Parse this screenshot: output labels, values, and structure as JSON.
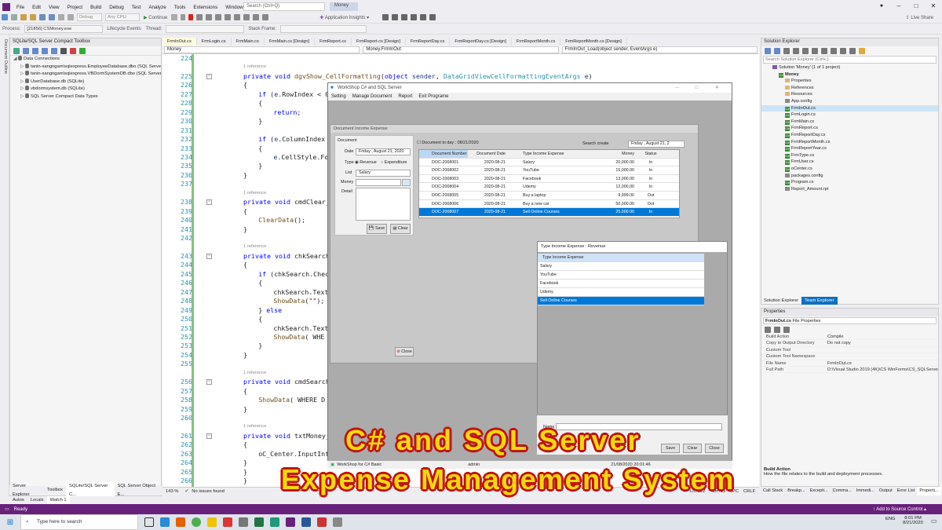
{
  "menubar": {
    "items": [
      "File",
      "Edit",
      "View",
      "Project",
      "Build",
      "Debug",
      "Test",
      "Analyze",
      "Tools",
      "Extensions",
      "Window",
      "Help"
    ],
    "search_placeholder": "Search (Ctrl+Q)",
    "solution_name": "Money",
    "live_share": "Live Share"
  },
  "toolbar": {
    "debug_config": "Debug",
    "platform": "Any CPU",
    "continue": "Continue",
    "insights": "Application Insights"
  },
  "toolbar2": {
    "process_label": "Process:",
    "process_value": "[21856] CSMoney.exe",
    "lifecycle": "Lifecycle Events",
    "thread": "Thread:",
    "stack_frame": "Stack Frame:"
  },
  "left_strip": {
    "label": "Document Outline"
  },
  "toolbox": {
    "title": "SQLite/SQL Server Compact Toolbox",
    "items": [
      {
        "label": "Data Connections",
        "level": 0
      },
      {
        "label": "tanin-sangngam\\sqlexpress.EmployeeDatabase.dbo (SQL Server)",
        "level": 1
      },
      {
        "label": "tanin-sangngam\\sqlexpress.VBDormSystemDB.dbo (SQL Server)",
        "level": 1
      },
      {
        "label": "UserDatabase.db (SQLite)",
        "level": 1
      },
      {
        "label": "vbdormsystem.db (SQLite)",
        "level": 1
      },
      {
        "label": "SQL Server Compact Data Types",
        "level": 1
      }
    ],
    "bottom_tabs": [
      "Server Explorer",
      "Toolbox",
      "SQLite/SQL Server C...",
      "SQL Server Object E..."
    ]
  },
  "editor": {
    "tabs": [
      "FrmInOut.cs",
      "FrmLogin.cs",
      "FrmMain.cs",
      "FrmMain.cs [Design]",
      "FrmReport.cs",
      "FrmReport.cs [Design]",
      "FrmReportDay.cs",
      "FrmReportDay.cs [Design]",
      "FrmReportMonth.cs",
      "FrmReportMonth.cs [Design]"
    ],
    "nav": {
      "project": "Money",
      "class": "Money.FrmInOut",
      "member": "FrmInOut_Load(object sender, EventArgs e)"
    },
    "ref_label": "1 reference",
    "lines": [
      {
        "n": "224",
        "code": ""
      },
      {
        "n": "225",
        "code": "private void dgvShow_CellFormatting(object sender, DataGridViewCellFormattingEventArgs e)",
        "ref": true
      },
      {
        "n": "226",
        "code": "{"
      },
      {
        "n": "227",
        "code": "    if (e.RowIndex < 0"
      },
      {
        "n": "228",
        "code": "    {"
      },
      {
        "n": "229",
        "code": "        return;"
      },
      {
        "n": "230",
        "code": "    }"
      },
      {
        "n": "231",
        "code": ""
      },
      {
        "n": "232",
        "code": "    if (e.ColumnIndex"
      },
      {
        "n": "233",
        "code": "    {"
      },
      {
        "n": "234",
        "code": "        e.CellStyle.Fo"
      },
      {
        "n": "235",
        "code": "    }"
      },
      {
        "n": "236",
        "code": "}"
      },
      {
        "n": "237",
        "code": ""
      },
      {
        "n": "238",
        "code": "private void cmdClear_",
        "ref": true
      },
      {
        "n": "239",
        "code": "{"
      },
      {
        "n": "240",
        "code": "    ClearData();"
      },
      {
        "n": "241",
        "code": "}"
      },
      {
        "n": "242",
        "code": ""
      },
      {
        "n": "243",
        "code": "private void chkSearch",
        "ref": true
      },
      {
        "n": "244",
        "code": "{"
      },
      {
        "n": "245",
        "code": "    if (chkSearch.Chec"
      },
      {
        "n": "246",
        "code": "    {"
      },
      {
        "n": "247",
        "code": "        chkSearch.Text"
      },
      {
        "n": "248",
        "code": "        ShowData(\"\");"
      },
      {
        "n": "249",
        "code": "    } else"
      },
      {
        "n": "250",
        "code": "    {"
      },
      {
        "n": "251",
        "code": "        chkSearch.Text"
      },
      {
        "n": "252",
        "code": "        ShowData(\" WHE"
      },
      {
        "n": "253",
        "code": "    }"
      },
      {
        "n": "254",
        "code": "}"
      },
      {
        "n": "255",
        "code": ""
      },
      {
        "n": "256",
        "code": "private void cmdSearch",
        "ref": true
      },
      {
        "n": "257",
        "code": "{"
      },
      {
        "n": "258",
        "code": "    ShowData(\" WHERE D"
      },
      {
        "n": "259",
        "code": "}"
      },
      {
        "n": "260",
        "code": ""
      },
      {
        "n": "261",
        "code": "private void txtMoney_",
        "ref": true
      },
      {
        "n": "262",
        "code": "{"
      },
      {
        "n": "263",
        "code": "    oC_Center.InputInt"
      },
      {
        "n": "264",
        "code": "}"
      },
      {
        "n": "265",
        "code": "}"
      },
      {
        "n": "266",
        "code": "}"
      },
      {
        "n": "267",
        "code": ""
      }
    ],
    "status": {
      "zoom": "143 %",
      "issues": "No issues found",
      "ln": "Ln: 122",
      "ch": "Ch: 13",
      "spc": "SPC",
      "crlf": "CRLF"
    }
  },
  "solution_explorer": {
    "title": "Solution Explorer",
    "search_placeholder": "Search Solution Explorer (Ctrl+;)",
    "items": [
      {
        "label": "Solution 'Money' (1 of 1 project)",
        "level": 0,
        "kind": "sln"
      },
      {
        "label": "Money",
        "level": 1,
        "kind": "proj"
      },
      {
        "label": "Properties",
        "level": 2,
        "kind": "folder"
      },
      {
        "label": "References",
        "level": 2,
        "kind": "folder"
      },
      {
        "label": "Resources",
        "level": 2,
        "kind": "folder"
      },
      {
        "label": "App.config",
        "level": 2,
        "kind": "file"
      },
      {
        "label": "FrmInOut.cs",
        "level": 2,
        "kind": "cs",
        "selected": true
      },
      {
        "label": "FrmLogin.cs",
        "level": 2,
        "kind": "cs"
      },
      {
        "label": "FrmMain.cs",
        "level": 2,
        "kind": "cs"
      },
      {
        "label": "FrmReport.cs",
        "level": 2,
        "kind": "cs"
      },
      {
        "label": "FrmReportDay.cs",
        "level": 2,
        "kind": "cs"
      },
      {
        "label": "FrmReportMonth.cs",
        "level": 2,
        "kind": "cs"
      },
      {
        "label": "FrmReportYear.cs",
        "level": 2,
        "kind": "cs"
      },
      {
        "label": "FrmType.cs",
        "level": 2,
        "kind": "cs"
      },
      {
        "label": "FrmUser.cs",
        "level": 2,
        "kind": "cs"
      },
      {
        "label": "oCenter.cs",
        "level": 2,
        "kind": "cs"
      },
      {
        "label": "packages.config",
        "level": 2,
        "kind": "file"
      },
      {
        "label": "Program.cs",
        "level": 2,
        "kind": "cs"
      },
      {
        "label": "Report_Amount.rpt",
        "level": 2,
        "kind": "file"
      }
    ],
    "tabs": [
      "Solution Explorer",
      "Team Explorer"
    ]
  },
  "properties": {
    "title": "Properties",
    "object": "FrmInOut.cs",
    "object_type": "File Properties",
    "rows": [
      {
        "k": "Build Action",
        "v": "Compile"
      },
      {
        "k": "Copy to Output Directory",
        "v": "Do not copy"
      },
      {
        "k": "Custom Tool",
        "v": ""
      },
      {
        "k": "Custom Tool Namespace",
        "v": ""
      },
      {
        "k": "File Name",
        "v": "FrmInOut.cs"
      },
      {
        "k": "Full Path",
        "v": "D:\\Visual Studio 2019 (4K)\\CS WinForms\\CS_SQLServer"
      }
    ],
    "desc_title": "Build Action",
    "desc_text": "How the file relates to the build and deployment processes.",
    "bottom_tabs": [
      "Call Stack",
      "Breakp...",
      "Excepti...",
      "Comma...",
      "Immedi...",
      "Output",
      "Error List",
      "Properti..."
    ]
  },
  "debug_tabs": [
    "Autos",
    "Locals",
    "Watch 1"
  ],
  "status": {
    "ready": "Ready",
    "source_control": "Add to Source Control"
  },
  "taskbar": {
    "search": "Type here to search",
    "time": "8:01 PM",
    "date": "8/21/2020",
    "lang": "ENG"
  },
  "app": {
    "title": "WorkShop C# and SQL Server",
    "menu": [
      "Setting",
      "Manage Document",
      "Report",
      "Exit Programe"
    ],
    "status": {
      "left": "WorkShop for C# Basic",
      "user": "admin",
      "datetime": "21/08/2020 20:01:46"
    },
    "income": {
      "title": "Document Income Expense",
      "group": "Document",
      "date_label": "Date",
      "date_value": "Friday    ,    August    21, 2020",
      "type_label": "Type",
      "revenue": "Revenue",
      "expenditure": "Expenditure",
      "list_label": "List",
      "list_value": "Salary",
      "money_label": "Money",
      "detail_label": "Detail",
      "save": "Save",
      "clear": "Clear",
      "close": "Close",
      "to_day_label": "Document to day : 08/21/2020",
      "search_create": "Search create",
      "search_date": "Friday    ,    August    21, 2",
      "grid_headers": [
        "Document Number",
        "Document Date",
        "Type Income Expense",
        "Money",
        "Status"
      ],
      "grid_rows": [
        [
          "DOC-2008001",
          "2020-08-21",
          "Salary",
          "20,000.00",
          "In"
        ],
        [
          "DOC-2008002",
          "2020-08-21",
          "YouTube",
          "15,000.00",
          "In"
        ],
        [
          "DOC-2008003",
          "2020-08-21",
          "Facebook",
          "13,000.00",
          "In"
        ],
        [
          "DOC-2008004",
          "2020-08-21",
          "Udemy",
          "12,000.00",
          "In"
        ],
        [
          "DOC-2008005",
          "2020-08-21",
          "Buy a laptop",
          "9,999.00",
          "Out"
        ],
        [
          "DOC-2008006",
          "2020-08-21",
          "Buy a new car",
          "50,000.00",
          "Out"
        ],
        [
          "DOC-2008007",
          "2020-08-21",
          "Sell Online Courses",
          "25,000.00",
          "In"
        ]
      ]
    },
    "type_window": {
      "title": "Type Income Expense : Revenue",
      "header": "Type Income Expense",
      "rows": [
        "Salary",
        "YouTube",
        "Facebook",
        "Udemy",
        "Sell Online Courses"
      ],
      "name_label": "Name",
      "save": "Save",
      "clear": "Clear",
      "close": "Close"
    }
  },
  "overlay": {
    "line1": "C# and SQL Server",
    "line2": "Expense Management System"
  }
}
